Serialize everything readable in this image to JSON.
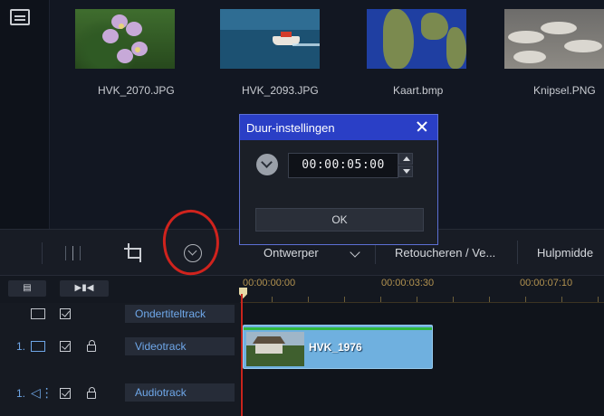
{
  "library": {
    "items": [
      {
        "label": "HVK_2070.JPG"
      },
      {
        "label": "HVK_2093.JPG"
      },
      {
        "label": "Kaart.bmp"
      },
      {
        "label": "Knipsel.PNG"
      }
    ]
  },
  "toolbar": {
    "designer_label": "Ontwerper",
    "retouch_label": "Retoucheren / Ve...",
    "help_label": "Hulpmidde"
  },
  "dialog": {
    "title": "Duur-instellingen",
    "duration_value": "00:00:05:00",
    "ok_label": "OK"
  },
  "timeline": {
    "ruler": [
      "00:00:00:00",
      "00:00:03:30",
      "00:00:07:10"
    ],
    "tracks": [
      {
        "number": "",
        "label": "Ondertiteltrack"
      },
      {
        "number": "1.",
        "label": "Videotrack"
      },
      {
        "number": "1.",
        "label": "Audiotrack"
      }
    ],
    "clip_name": "HVK_1976"
  },
  "colors": {
    "accent": "#2a3fc6",
    "track_label": "#6fa8ea",
    "playhead": "#c8241c",
    "annotation": "#d0231d",
    "clip": "#6fb0df"
  }
}
